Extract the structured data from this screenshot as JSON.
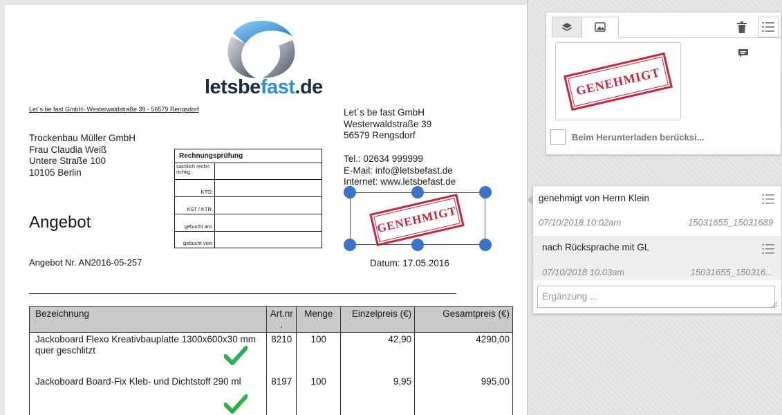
{
  "document": {
    "logo_text_a": "letsbe",
    "logo_text_b": "fast",
    "logo_text_c": ".de",
    "sender_line": "Let´s be fast GmbH- Westerwaldstraße 39 - 56579 Rengsdorf",
    "recipient": [
      "Trockenbau Müller GmbH",
      "Frau Claudia Weiß",
      "Untere Straße 100",
      "10105 Berlin"
    ],
    "company": [
      "Let´s be fast GmbH",
      "Westerwaldstraße 39",
      "56579 Rengsdorf"
    ],
    "contact": [
      "Tel.: 02634 999999",
      "E-Mail: info@letsbefast.de",
      "Internet: www.letsbefast.de"
    ],
    "rechnungspruefung": {
      "title": "Rechnungsprüfung",
      "rows": [
        "sachlich rechn. richtig:",
        "KTO:",
        "KST / KTR:",
        "gebucht am:",
        "gebucht von:"
      ]
    },
    "title": "Angebot",
    "number": "Angebot Nr. AN2016-05-257",
    "date": "Datum: 17.05.2016",
    "stamp": "GENEHMIGT",
    "table": {
      "headers": [
        "Bezeichnung",
        "Art.nr .",
        "Menge",
        "Einzelpreis (€)",
        "Gesamtpreis (€)"
      ],
      "rows": [
        [
          "Jackoboard Flexo Kreativbauplatte 1300x600x30 mm quer geschlitzt",
          "8210",
          "100",
          "42,90",
          "4290,00"
        ],
        [
          "Jackoboard Board-Fix Kleb- und Dichtstoff 290 ml",
          "8197",
          "100",
          "9,95",
          "995,00"
        ]
      ]
    }
  },
  "stamp_panel": {
    "preview_stamp": "GENEHMIGT",
    "checkbox_label": "Beim Herunterladen berücksi..."
  },
  "comments": {
    "items": [
      {
        "text": "genehmigt von Herrn Klein",
        "date": "07/10/2018 10:02am",
        "user": "15031655_15031689"
      },
      {
        "text": "nach Rücksprache mit GL",
        "date": "07/10/2018 10:03am",
        "user": "15031655_150316..."
      }
    ],
    "input_placeholder": "Ergänzung ..."
  },
  "colors": {
    "stamp_red": "#c7263a",
    "handle_blue": "#3b73c8",
    "check_green": "#2bb24c",
    "logo_blue": "#2b8fd8"
  }
}
